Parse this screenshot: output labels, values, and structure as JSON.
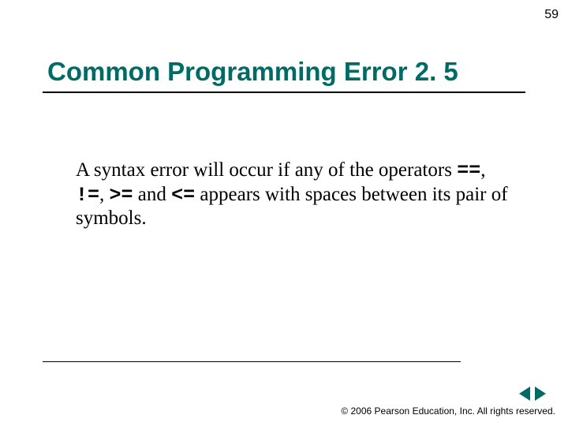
{
  "page_number": "59",
  "title": "Common Programming Error 2. 5",
  "body": {
    "lead": "A syntax error will occur if any of the operators ",
    "op1": "==",
    "sep1": ", ",
    "op2": "!=",
    "sep2": ", ",
    "op3": ">=",
    "mid": " and ",
    "op4": "<=",
    "tail": "  appears with spaces between its pair of symbols."
  },
  "copyright": "© 2006 Pearson Education, Inc.  All rights reserved.",
  "colors": {
    "accent": "#006a66"
  }
}
